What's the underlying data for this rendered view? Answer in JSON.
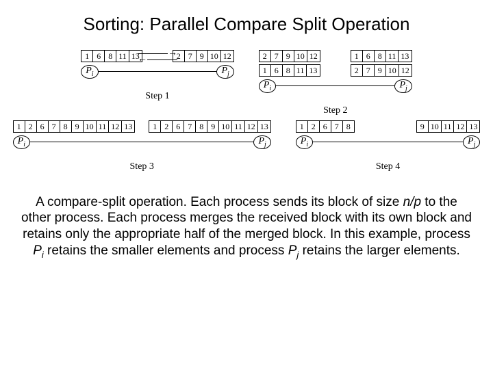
{
  "title": "Sorting: Parallel Compare Split Operation",
  "proc_i": "P",
  "proc_i_sub": "i",
  "proc_j": "P",
  "proc_j_sub": "j",
  "steps": {
    "s1": {
      "label": "Step 1",
      "left": [
        "1",
        "6",
        "8",
        "11",
        "13"
      ],
      "right": [
        "2",
        "7",
        "9",
        "10",
        "12"
      ],
      "exchange": true
    },
    "s2": {
      "label": "Step 2",
      "left_top": [
        "2",
        "7",
        "9",
        "10",
        "12"
      ],
      "left_bottom": [
        "1",
        "6",
        "8",
        "11",
        "13"
      ],
      "right_top": [
        "1",
        "6",
        "8",
        "11",
        "13"
      ],
      "right_bottom": [
        "2",
        "7",
        "9",
        "10",
        "12"
      ]
    },
    "s3": {
      "label": "Step 3",
      "left": [
        "1",
        "2",
        "6",
        "7",
        "8",
        "9",
        "10",
        "11",
        "12",
        "13"
      ],
      "right": [
        "1",
        "2",
        "6",
        "7",
        "8",
        "9",
        "10",
        "11",
        "12",
        "13"
      ]
    },
    "s4": {
      "label": "Step 4",
      "left": [
        "1",
        "2",
        "6",
        "7",
        "8"
      ],
      "right": [
        "9",
        "10",
        "11",
        "12",
        "13"
      ]
    }
  },
  "caption": {
    "t1": "A compare-split operation. Each process sends its block of size ",
    "np": "n/p",
    "t2": " to the other process. Each process merges the received block with its own block and retains only the appropriate half of the merged block. In this example, process ",
    "pi": "P",
    "pi_sub": "i",
    "t3": " retains the smaller elements and process ",
    "pj": "P",
    "pj_sub": "j",
    "t4": " retains the larger elements."
  }
}
